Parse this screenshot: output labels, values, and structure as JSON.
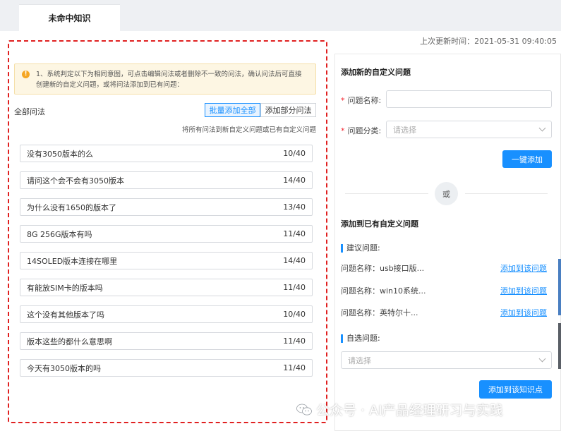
{
  "tab": {
    "label": "未命中知识"
  },
  "updated": {
    "text": "上次更新时间：2021-05-31 09:40:05"
  },
  "notice": {
    "text": "1、系统判定以下为相同意图，可点击编辑问法或者删除不一致的问法，确认问法后可直接创建新的自定义问题，或将问法添加到已有问题："
  },
  "left": {
    "all_label": "全部问法",
    "batch_all": "批量添加全部",
    "batch_part": "添加部分问法",
    "hint": "将所有问法到新自定义问题或已有自定义问题",
    "items": [
      {
        "text": "没有3050版本的么",
        "count": "10/40"
      },
      {
        "text": "请问这个会不会有3050版本",
        "count": "14/40"
      },
      {
        "text": "为什么没有1650的版本了",
        "count": "13/40"
      },
      {
        "text": "8G 256G版本有吗",
        "count": "11/40"
      },
      {
        "text": "14SOLED版本连接在哪里",
        "count": "14/40"
      },
      {
        "text": "有能放SIM卡的版本吗",
        "count": "11/40"
      },
      {
        "text": "这个没有其他版本了吗",
        "count": "10/40"
      },
      {
        "text": "版本这些的都什么意思啊",
        "count": "11/40"
      },
      {
        "text": "今天有3050版本的吗",
        "count": "11/40"
      }
    ]
  },
  "right": {
    "new_title": "添加新的自定义问题",
    "name_label": "问题名称:",
    "cat_label": "问题分类:",
    "cat_placeholder": "请选择",
    "one_click": "一键添加",
    "or": "或",
    "existing_title": "添加到已有自定义问题",
    "suggest_label": "建议问题:",
    "suggestions": [
      {
        "name": "问题名称：usb接口版...",
        "link": "添加到该问题"
      },
      {
        "name": "问题名称：win10系统...",
        "link": "添加到该问题"
      },
      {
        "name": "问题名称：英特尔十...",
        "link": "添加到该问题"
      }
    ],
    "optional_label": "自选问题:",
    "optional_placeholder": "请选择",
    "add_knowledge": "添加到该知识点"
  },
  "watermark": {
    "text": "公众号 · AI产品经理研习与实践"
  },
  "colors": {
    "primary": "#1890ff",
    "danger": "#e02020",
    "notice_bg": "#fdf6e3"
  }
}
